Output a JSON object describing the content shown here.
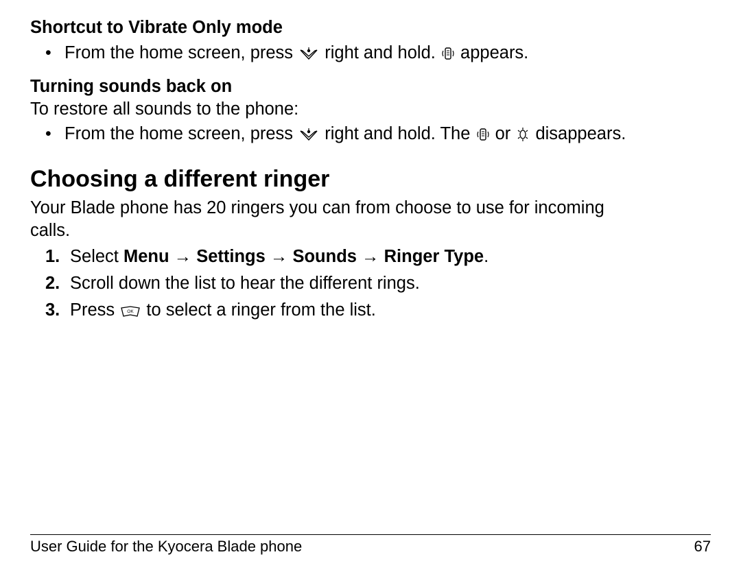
{
  "section1": {
    "heading": "Shortcut to Vibrate Only mode",
    "bullet_pre": "From the home screen, press ",
    "bullet_mid": " right and hold. ",
    "bullet_post": " appears."
  },
  "section2": {
    "heading": "Turning sounds back on",
    "intro": "To restore all sounds to the phone:",
    "bullet_pre": "From the home screen, press ",
    "bullet_mid": " right and hold. The ",
    "bullet_or": " or ",
    "bullet_post": " disappears."
  },
  "main_heading": "Choosing a different ringer",
  "main_intro": "Your Blade phone has 20 ringers you can from choose to use for incoming calls.",
  "steps": {
    "n1": "1.",
    "s1_pre": "Select ",
    "s1_bold": "Menu → Settings → Sounds → Ringer Type",
    "s1_post": ".",
    "n2": "2.",
    "s2": "Scroll down the list to hear the different rings.",
    "n3": "3.",
    "s3_pre": "Press ",
    "s3_post": " to select a ringer from the list."
  },
  "footer_left": "User Guide for the Kyocera Blade phone",
  "footer_right": "67",
  "icons": {
    "nav_key": "nav-key-icon",
    "vibrate": "vibrate-icon",
    "light": "light-icon",
    "ok_key": "ok-key-icon"
  }
}
